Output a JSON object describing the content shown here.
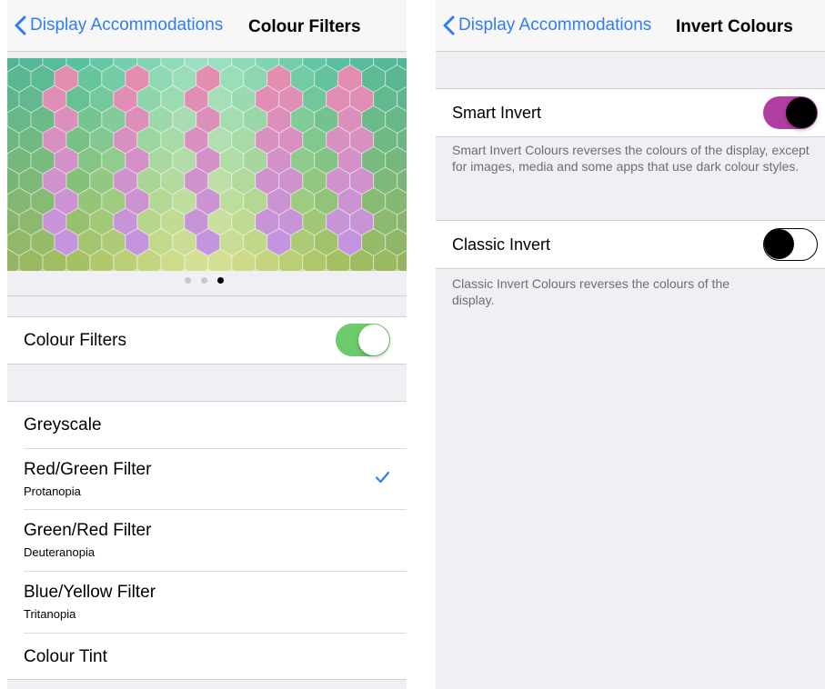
{
  "left": {
    "back_label": "Display Accommodations",
    "title": "Colour Filters",
    "toggle_label": "Colour Filters",
    "toggle_state": "on",
    "toggle_color": "#6ccb6b",
    "filters": [
      {
        "label": "Greyscale",
        "sub": ""
      },
      {
        "label": "Red/Green Filter",
        "sub": "Protanopia",
        "selected": true
      },
      {
        "label": "Green/Red Filter",
        "sub": "Deuteranopia"
      },
      {
        "label": "Blue/Yellow Filter",
        "sub": "Tritanopia"
      },
      {
        "label": "Colour Tint",
        "sub": ""
      }
    ],
    "page_indicator": {
      "pages": 3,
      "current": 3
    }
  },
  "right": {
    "back_label": "Display Accommodations",
    "title": "Invert Colours",
    "smart": {
      "label": "Smart Invert",
      "state": "on",
      "toggle_color": "#b13fa2",
      "footer": "Smart Invert Colours reverses the colours of the display, except for images, media and some apps that use dark colour styles."
    },
    "classic": {
      "label": "Classic Invert",
      "state": "off",
      "footer": "Classic Invert Colours reverses the colours of the display."
    }
  },
  "accent_color": "#2f7cf6",
  "icons": [
    "chevron-left-icon",
    "checkmark-icon"
  ]
}
